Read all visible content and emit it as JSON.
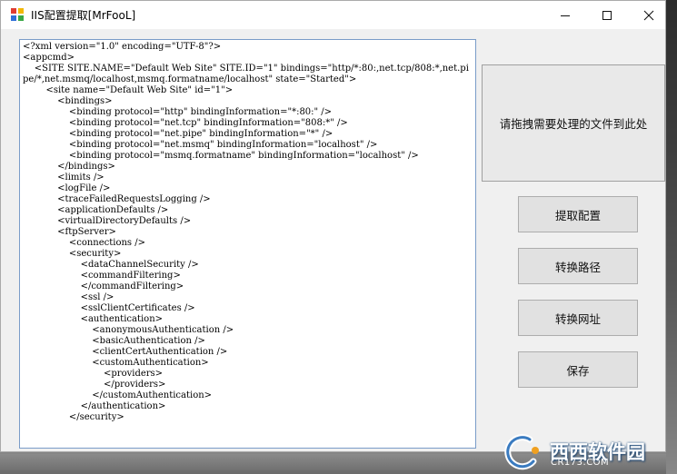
{
  "window": {
    "title": "IIS配置提取[MrFooL]"
  },
  "editor": {
    "content": "<?xml version=\"1.0\" encoding=\"UTF-8\"?>\n<appcmd>\n    <SITE SITE.NAME=\"Default Web Site\" SITE.ID=\"1\" bindings=\"http/*:80:,net.tcp/808:*,net.pipe/*,net.msmq/localhost,msmq.formatname/localhost\" state=\"Started\">\n        <site name=\"Default Web Site\" id=\"1\">\n            <bindings>\n                <binding protocol=\"http\" bindingInformation=\"*:80:\" />\n                <binding protocol=\"net.tcp\" bindingInformation=\"808:*\" />\n                <binding protocol=\"net.pipe\" bindingInformation=\"*\" />\n                <binding protocol=\"net.msmq\" bindingInformation=\"localhost\" />\n                <binding protocol=\"msmq.formatname\" bindingInformation=\"localhost\" />\n            </bindings>\n            <limits />\n            <logFile />\n            <traceFailedRequestsLogging />\n            <applicationDefaults />\n            <virtualDirectoryDefaults />\n            <ftpServer>\n                <connections />\n                <security>\n                    <dataChannelSecurity />\n                    <commandFiltering>\n                    </commandFiltering>\n                    <ssl />\n                    <sslClientCertificates />\n                    <authentication>\n                        <anonymousAuthentication />\n                        <basicAuthentication />\n                        <clientCertAuthentication />\n                        <customAuthentication>\n                            <providers>\n                            </providers>\n                        </customAuthentication>\n                    </authentication>\n                </security>"
  },
  "drop_zone": {
    "label": "请拖拽需要处理的文件到此处"
  },
  "buttons": {
    "extract": "提取配置",
    "convert_path": "转换路径",
    "convert_url": "转换网址",
    "save": "保存"
  },
  "watermark": {
    "brand": "西西软件园",
    "domain": "CR173.COM"
  },
  "colors": {
    "window_bg": "#f0f0f0",
    "titlebar_bg": "#ffffff",
    "editor_border": "#7a9cc8",
    "button_bg": "#e1e1e1"
  }
}
